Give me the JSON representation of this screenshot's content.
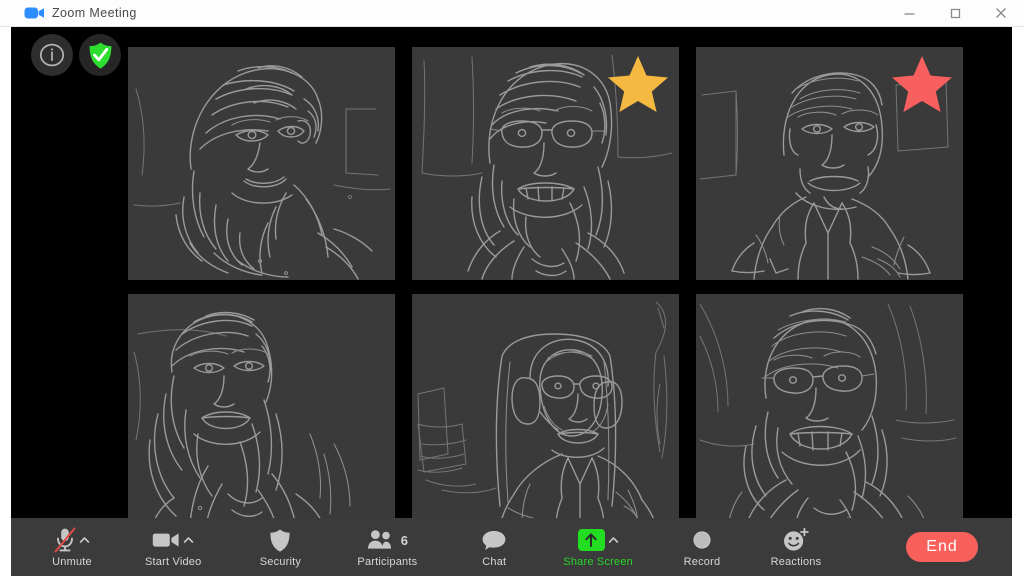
{
  "window": {
    "title": "Zoom Meeting",
    "logo_icon": "zoom-camera-icon",
    "controls": [
      {
        "name": "minimize",
        "glyph": "minimize-icon"
      },
      {
        "name": "maximize",
        "glyph": "maximize-icon"
      },
      {
        "name": "close",
        "glyph": "close-icon"
      }
    ]
  },
  "status_badges": [
    {
      "name": "meeting-info",
      "icon": "info-icon",
      "label": "i",
      "color": "#b4b4b4"
    },
    {
      "name": "encryption-status",
      "icon": "shield-check-icon",
      "label": "",
      "color": "#2ede2e"
    }
  ],
  "gallery": {
    "tiles": [
      {
        "id": "tile-1",
        "position": "row1-col1",
        "sketch": "woman-long-hair-portrait",
        "reaction": null
      },
      {
        "id": "tile-2",
        "position": "row1-col2",
        "sketch": "woman-glasses-portrait",
        "reaction": "star-yellow"
      },
      {
        "id": "tile-3",
        "position": "row1-col3",
        "sketch": "man-collared-shirt-portrait",
        "reaction": "star-red"
      },
      {
        "id": "tile-4",
        "position": "row2-col1",
        "sketch": "woman-wavy-hair-portrait",
        "reaction": null
      },
      {
        "id": "tile-5",
        "position": "row2-col2",
        "sketch": "person-headphones-glasses-portrait",
        "reaction": null
      },
      {
        "id": "tile-6",
        "position": "row2-col3",
        "sketch": "person-glasses-smiling-portrait",
        "reaction": null
      }
    ]
  },
  "reactions": {
    "star_yellow_color": "#f5b942",
    "star_red_color": "#f85f5f"
  },
  "toolbar": {
    "items": [
      {
        "name": "unmute",
        "label": "Unmute",
        "icon": "microphone-muted-icon",
        "has_caret": true,
        "accent": "#e04a4a"
      },
      {
        "name": "start-video",
        "label": "Start Video",
        "icon": "video-camera-icon",
        "has_caret": true,
        "accent": "#c6c6c6"
      },
      {
        "name": "security",
        "label": "Security",
        "icon": "shield-icon",
        "has_caret": false,
        "accent": "#c6c6c6"
      },
      {
        "name": "participants",
        "label": "Participants",
        "icon": "people-icon",
        "has_caret": false,
        "count": "6",
        "accent": "#c6c6c6"
      },
      {
        "name": "chat",
        "label": "Chat",
        "icon": "speech-bubble-icon",
        "has_caret": false,
        "accent": "#c6c6c6"
      },
      {
        "name": "share-screen",
        "label": "Share Screen",
        "icon": "up-arrow-icon",
        "has_caret": true,
        "accent": "#22dd22"
      },
      {
        "name": "record",
        "label": "Record",
        "icon": "record-circle-icon",
        "has_caret": false,
        "accent": "#c6c6c6"
      },
      {
        "name": "reactions",
        "label": "Reactions",
        "icon": "smiley-plus-icon",
        "has_caret": false,
        "accent": "#c6c6c6"
      }
    ],
    "end_button": {
      "label": "End",
      "color": "#f8605c"
    }
  },
  "colors": {
    "stage_background": "#000000",
    "tile_background": "#3a3a3a",
    "toolbar_background": "#3b3b3b",
    "sketch_stroke": "#9a9a9a",
    "title_bar_background": "#fdfdfd"
  }
}
